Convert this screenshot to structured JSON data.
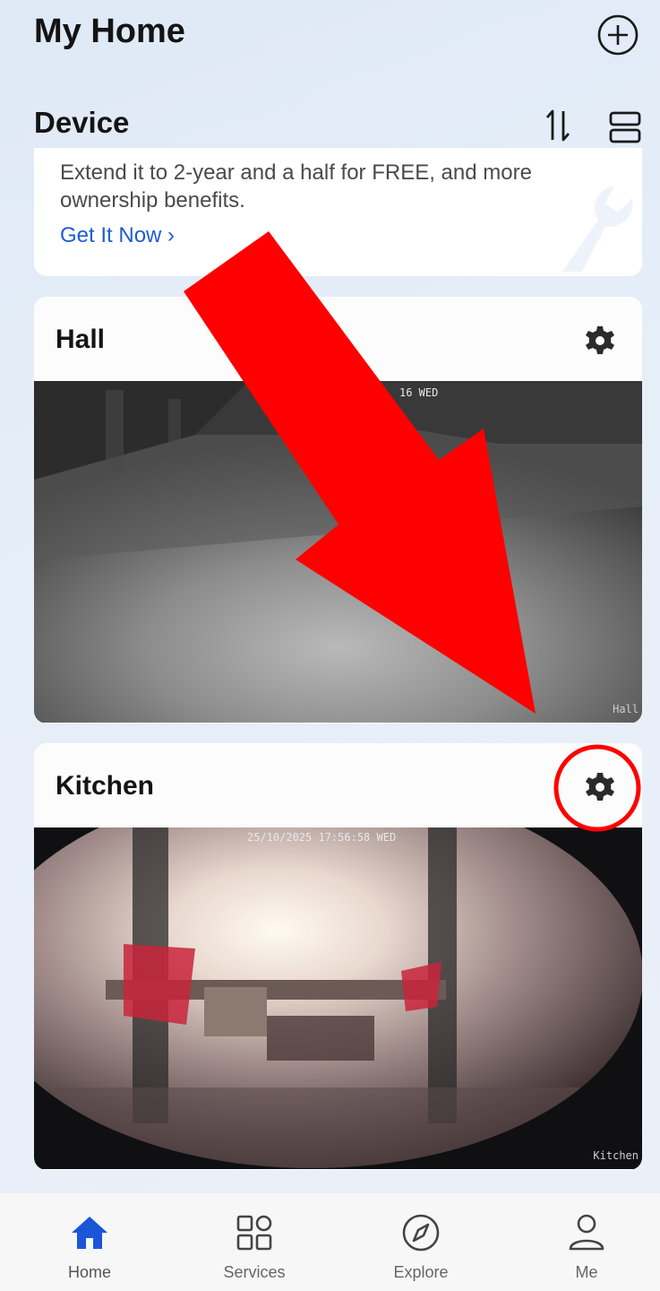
{
  "header": {
    "title": "My Home"
  },
  "section": {
    "title": "Device"
  },
  "promo": {
    "text": "Extend it to 2-year and a half for FREE, and more ownership benefits.",
    "link_label": "Get It Now"
  },
  "cameras": [
    {
      "name": "Hall",
      "timestamp": "16 WED",
      "feed_label": "Hall"
    },
    {
      "name": "Kitchen",
      "timestamp": "25/10/2025 17:56:58 WED",
      "feed_label": "Kitchen"
    }
  ],
  "tabs": [
    {
      "label": "Home",
      "icon": "home-icon",
      "active": true
    },
    {
      "label": "Services",
      "icon": "services-grid-icon",
      "active": false
    },
    {
      "label": "Explore",
      "icon": "compass-icon",
      "active": false
    },
    {
      "label": "Me",
      "icon": "person-icon",
      "active": false
    }
  ],
  "colors": {
    "accent": "#1d5cd6",
    "annotation": "#ff0000",
    "tab_active": "#1b56d8"
  }
}
